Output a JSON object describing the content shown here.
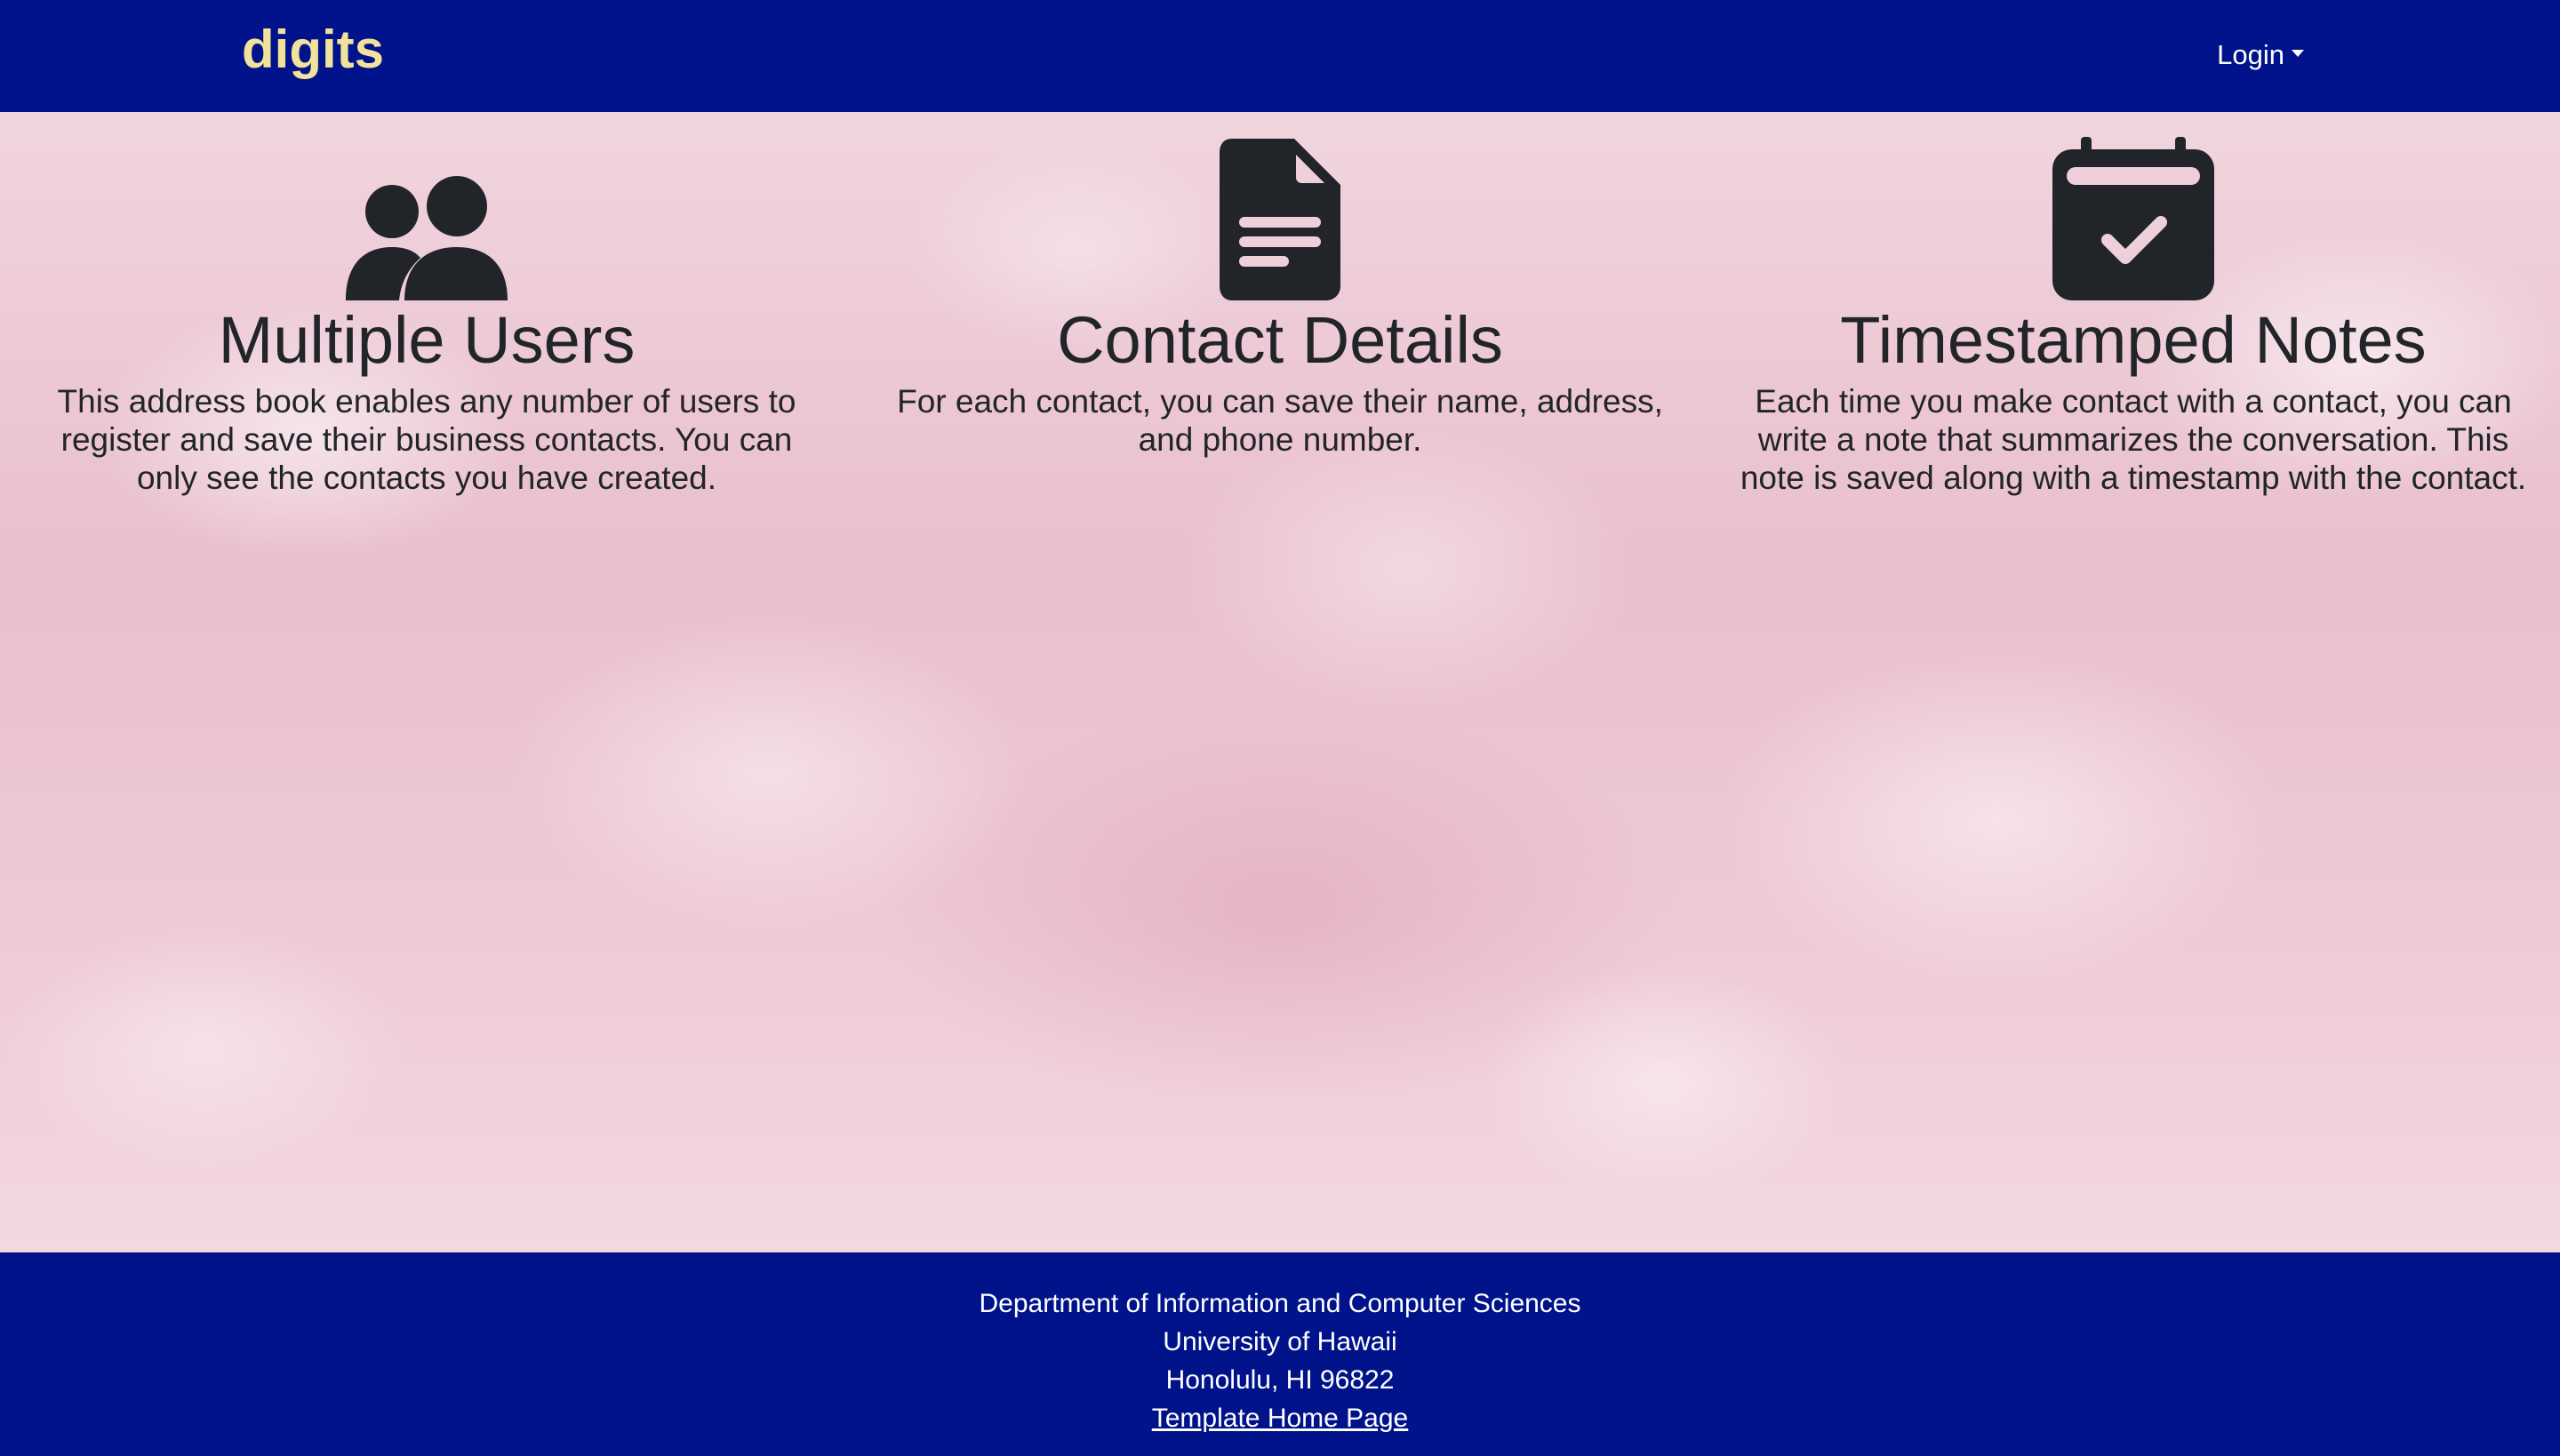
{
  "navbar": {
    "brand": "digits",
    "login_label": "Login",
    "colors": {
      "background": "#00138a",
      "brand": "#f3e39a"
    }
  },
  "features": [
    {
      "icon": "users-icon",
      "title": "Multiple Users",
      "text": "This address book enables any number of users to register and save their business contacts. You can only see the contacts you have created."
    },
    {
      "icon": "file-icon",
      "title": "Contact Details",
      "text": "For each contact, you can save their name, address, and phone number."
    },
    {
      "icon": "calendar-check-icon",
      "title": "Timestamped Notes",
      "text": "Each time you make contact with a contact, you can write a note that summarizes the conversation. This note is saved along with a timestamp with the contact."
    }
  ],
  "footer": {
    "line1": "Department of Information and Computer Sciences",
    "line2": "University of Hawaii",
    "line3": "Honolulu, HI 96822",
    "link_label": "Template Home Page"
  }
}
